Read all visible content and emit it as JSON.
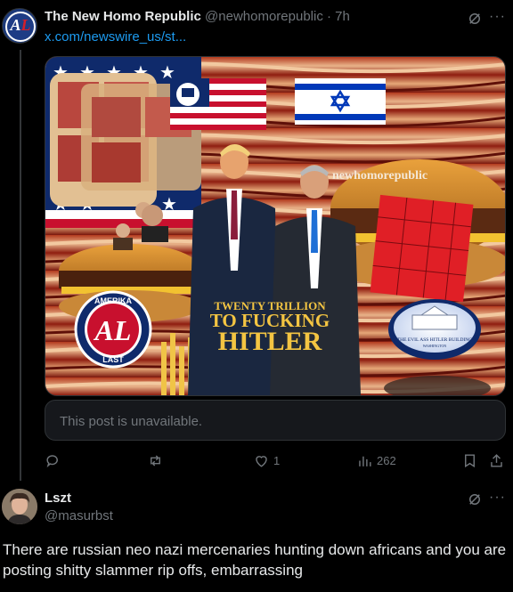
{
  "post1": {
    "display_name": "The New Homo Republic",
    "handle": "@newhomorepublic",
    "separator": "·",
    "time": "7h",
    "link": "x.com/newswire_us/st...",
    "avatar_text": "AL",
    "media": {
      "headline_line1": "TWENTY TRILLION",
      "headline_line2": "TO FUCKING",
      "headline_line3": "HITLER",
      "watermark": "newhomorepublic",
      "badge_top": "AMERIKA",
      "badge_bottom": "LAST",
      "badge_letters": "AL",
      "seal_text": "THE EVIL ASS HITLER BUILDING",
      "seal_sub": "WASHINGTON"
    },
    "quote_unavailable": "This post is unavailable.",
    "actions": {
      "reply_count": "",
      "repost_count": "",
      "like_count": "1",
      "views_count": "262"
    },
    "icons": {
      "grok": "grok-icon",
      "more": "more-icon",
      "reply": "reply-icon",
      "repost": "repost-icon",
      "like": "heart-icon",
      "views": "views-icon",
      "bookmark": "bookmark-icon",
      "share": "share-icon"
    }
  },
  "post2": {
    "display_name": "Lszt",
    "handle": "@masurbst",
    "text": "There are russian neo nazi mercenaries hunting down africans and you are posting shitty slammer rip offs, embarrassing"
  },
  "colors": {
    "background": "#000000",
    "text": "#e7e9ea",
    "muted": "#71767b",
    "link": "#1d9bf0",
    "border": "#2f3336"
  }
}
